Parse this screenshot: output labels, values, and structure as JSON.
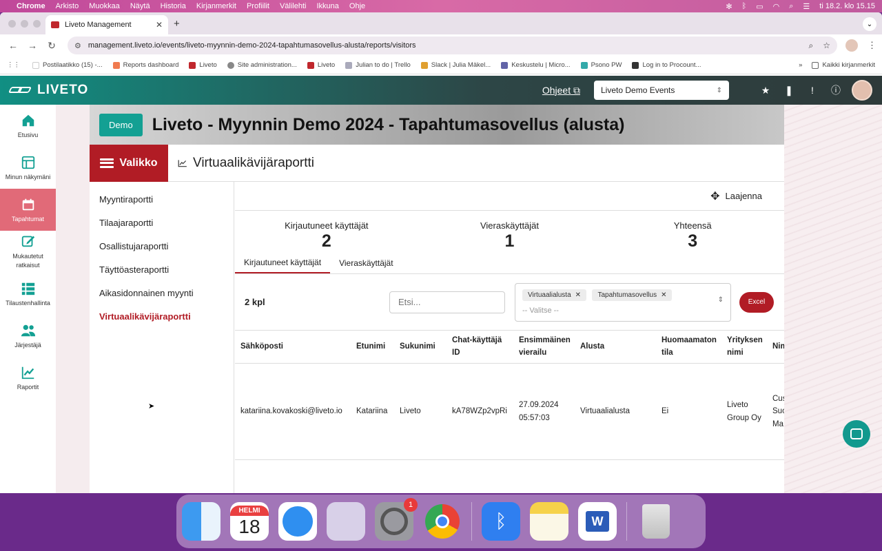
{
  "menubar": {
    "app": "Chrome",
    "items": [
      "Arkisto",
      "Muokkaa",
      "Näytä",
      "Historia",
      "Kirjanmerkit",
      "Profiilit",
      "Välilehti",
      "Ikkuna",
      "Ohje"
    ],
    "clock": "ti 18.2. klo 15.15"
  },
  "browser": {
    "tab_title": "Liveto Management",
    "url": "management.liveto.io/events/liveto-myynnin-demo-2024-tapahtumasovellus-alusta/reports/visitors",
    "bookmarks": [
      "Postilaatikko (15) -...",
      "Reports dashboard",
      "Liveto",
      "Site administration...",
      "Liveto",
      "Julian to do | Trello",
      "Slack | Julia Mäkel...",
      "Keskustelu | Micro...",
      "Psono PW",
      "Log in to Procount..."
    ],
    "all_bookmarks": "Kaikki kirjanmerkit"
  },
  "app": {
    "logo": "LIVETO",
    "help_link": "Ohjeet",
    "event_select": "Liveto Demo Events"
  },
  "sidebar": {
    "items": [
      {
        "label": "Etusivu"
      },
      {
        "label": "Minun näkymäni"
      },
      {
        "label": "Tapahtumat"
      },
      {
        "label": "Mukautetut ratkaisut"
      },
      {
        "label": "Tilaustenhallinta"
      },
      {
        "label": "Järjestäjä"
      },
      {
        "label": "Raportit"
      }
    ]
  },
  "banner": {
    "badge": "Demo",
    "title": "Liveto - Myynnin Demo 2024 - Tapahtumasovellus (alusta)"
  },
  "panel": {
    "menu_button": "Valikko",
    "report_title": "Virtuaalikävijäraportti",
    "menu": [
      "Myyntiraportti",
      "Tilaajaraportti",
      "Osallistujaraportti",
      "Täyttöasteraportti",
      "Aikasidonnainen myynti",
      "Virtuaalikävijäraportti"
    ],
    "expand": "Laajenna"
  },
  "stats": [
    {
      "label": "Kirjautuneet käyttäjät",
      "value": "2"
    },
    {
      "label": "Vieraskäyttäjät",
      "value": "1"
    },
    {
      "label": "Yhteensä",
      "value": "3"
    }
  ],
  "tabs": [
    "Kirjautuneet käyttäjät",
    "Vieraskäyttäjät"
  ],
  "filters": {
    "count": "2 kpl",
    "search_placeholder": "Etsi...",
    "chips": [
      "Virtuaalialusta",
      "Tapahtumasovellus"
    ],
    "select_placeholder": "-- Valitse --",
    "excel": "Excel"
  },
  "table": {
    "headers": [
      "Sähköposti",
      "Etunimi",
      "Sukunimi",
      "Chat-käyttäjä ID",
      "Ensimmäinen vierailu",
      "Alusta",
      "Huomaamaton tila",
      "Yrityksen nimi",
      "Nim"
    ],
    "rows": [
      [
        "katariina.kovakoski@liveto.io",
        "Katariina",
        "Liveto",
        "kA78WZp2vpRi",
        "27.09.2024 05:57:03",
        "Virtuaalialusta",
        "Ei",
        "Liveto Group Oy",
        "Cus Suc Ma"
      ]
    ]
  },
  "dock": {
    "calendar_month": "HELMI",
    "calendar_day": "18",
    "settings_badge": "1"
  },
  "colors": {
    "brand_red": "#b11c25",
    "brand_teal": "#13a093",
    "sidebar_active": "#e16a78"
  }
}
